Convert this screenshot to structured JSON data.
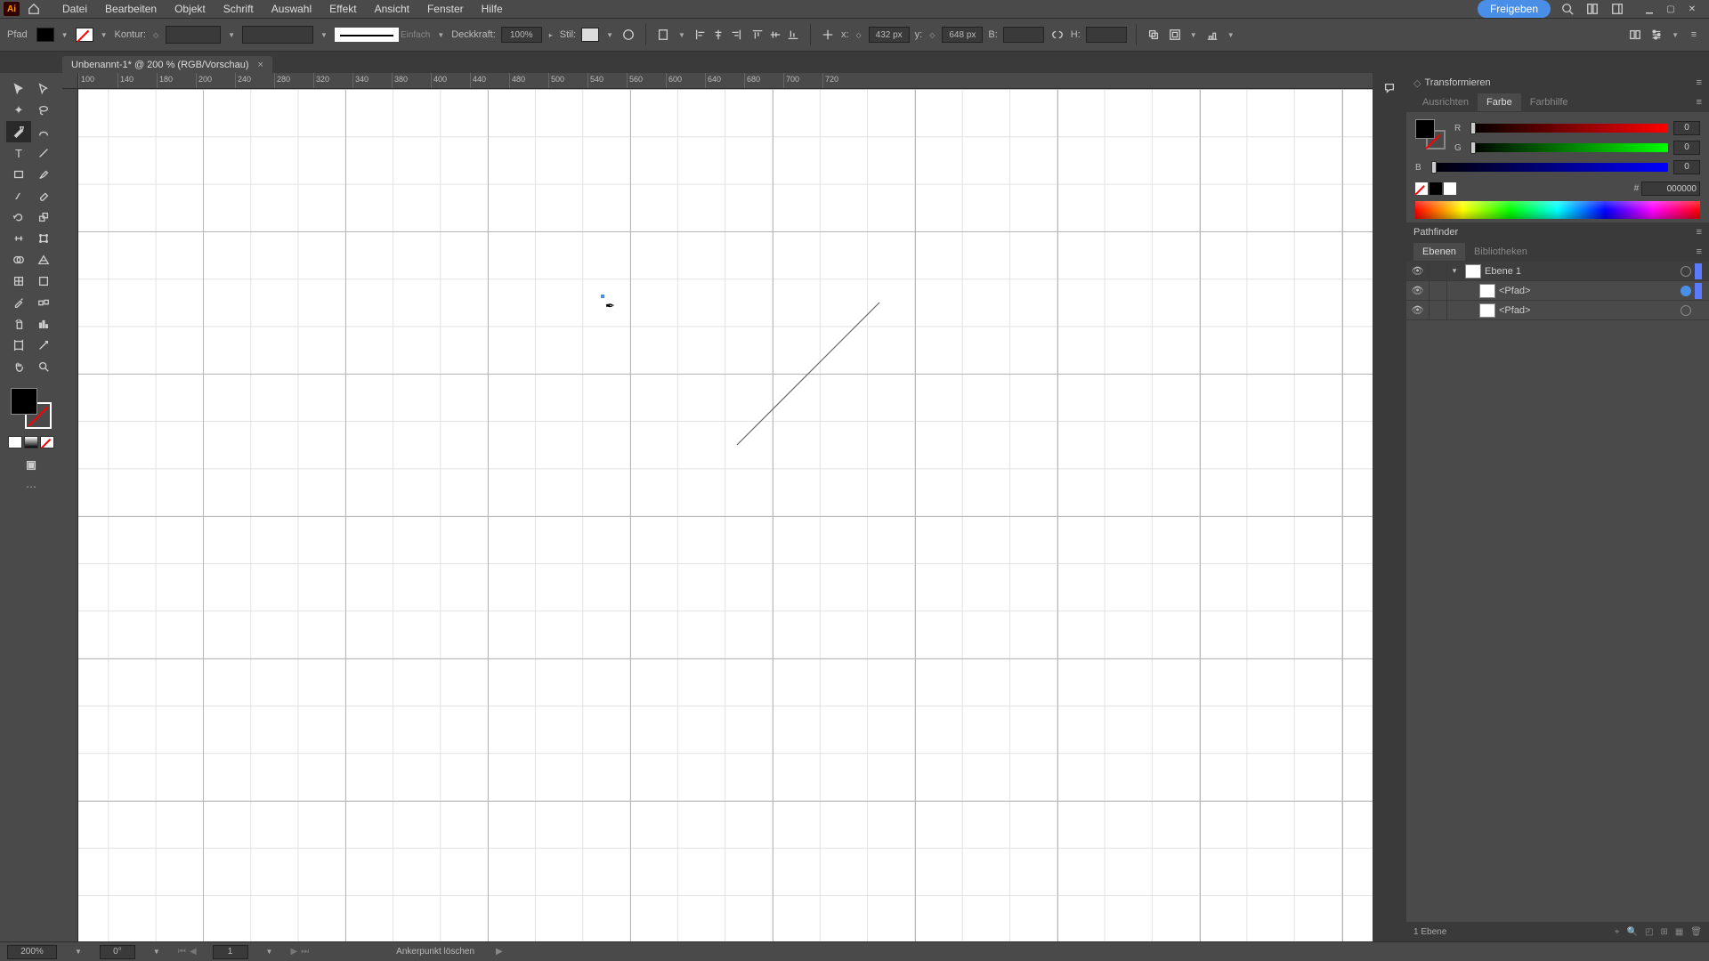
{
  "menu": {
    "items": [
      "Datei",
      "Bearbeiten",
      "Objekt",
      "Schrift",
      "Auswahl",
      "Effekt",
      "Ansicht",
      "Fenster",
      "Hilfe"
    ],
    "share": "Freigeben"
  },
  "options": {
    "mode": "Pfad",
    "kontur_label": "Kontur:",
    "stroke_style": "Einfach",
    "deckkraft_label": "Deckkraft:",
    "deckkraft_value": "100%",
    "stil_label": "Stil:",
    "x_label": "x:",
    "x_value": "432 px",
    "y_label": "y:",
    "y_value": "648 px",
    "b_label": "B:",
    "h_label": "H:"
  },
  "tab": {
    "title": "Unbenannt-1* @ 200 % (RGB/Vorschau)"
  },
  "ruler": {
    "ticks": [
      "100",
      "140",
      "180",
      "200",
      "240",
      "280",
      "320",
      "340",
      "380",
      "400",
      "440",
      "480",
      "500",
      "540",
      "560",
      "600",
      "640",
      "680",
      "700",
      "720"
    ]
  },
  "panels": {
    "transform": "Transformieren",
    "ausrichten": "Ausrichten",
    "farbe": "Farbe",
    "farbhilfe": "Farbhilfe",
    "pathfinder": "Pathfinder",
    "ebenen": "Ebenen",
    "bibliotheken": "Bibliotheken"
  },
  "color": {
    "r": "0",
    "g": "0",
    "b": "0",
    "hex": "000000"
  },
  "layers": {
    "layer1": "Ebene 1",
    "path": "<Pfad>",
    "footer": "1 Ebene"
  },
  "status": {
    "zoom": "200%",
    "angle": "0°",
    "artboard": "1",
    "hint": "Ankerpunkt löschen"
  }
}
